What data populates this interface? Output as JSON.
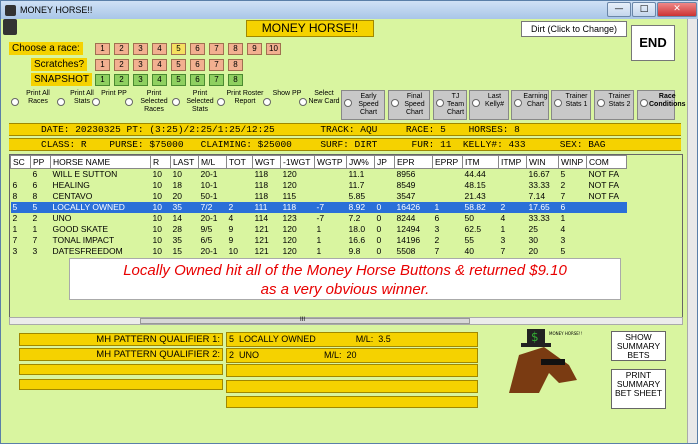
{
  "window": {
    "title": "MONEY HORSE!!",
    "close_label": "✕",
    "min_label": "—",
    "max_label": "□"
  },
  "header": {
    "app_title": "MONEY HORSE!!",
    "dirt_button": "Dirt (Click to Change)",
    "end_button": "END"
  },
  "race_row": {
    "label": "Choose  a race:",
    "options": [
      "1",
      "2",
      "3",
      "4",
      "5",
      "6",
      "7",
      "8",
      "9",
      "10"
    ],
    "selected": "5"
  },
  "scratch_row": {
    "label": "Scratches?",
    "options": [
      "1",
      "2",
      "3",
      "4",
      "5",
      "6",
      "7",
      "8"
    ]
  },
  "snapshot_row": {
    "label": "SNAPSHOT",
    "options": [
      "1",
      "2",
      "3",
      "4",
      "5",
      "6",
      "7",
      "8"
    ]
  },
  "print_options": [
    {
      "label": "Print All Races"
    },
    {
      "label": "Print All Stats"
    },
    {
      "label": "Print PP"
    },
    {
      "label": "Print Selected Races"
    },
    {
      "label": "Print Selected Stats"
    },
    {
      "label": "Print Roster Report"
    },
    {
      "label": "Show PP"
    },
    {
      "label": "Select New Card"
    }
  ],
  "chart_buttons": [
    {
      "label": "Early Speed Chart"
    },
    {
      "label": "Final Speed Chart"
    },
    {
      "label": "TJ Team Chart"
    },
    {
      "label": "Last Kelly#"
    },
    {
      "label": "Earning Chart"
    },
    {
      "label": "Trainer Stats 1"
    },
    {
      "label": "Trainer Stats 2"
    },
    {
      "label": "Race Conditions"
    }
  ],
  "info1": "DATE: 20230325 PT: (3:25)/2:25/1:25/12:25        TRACK: AQU     RACE: 5    HORSES: 8",
  "info2": "CLASS: R    PURSE: $75000   CLAIMING: $25000     SURF: DIRT      FUR: 11  KELLY#: 433      SEX: BAG",
  "table": {
    "headers": [
      "SC",
      "PP",
      "HORSE NAME",
      "R",
      "LAST",
      "M/L",
      "TOT",
      "WGT",
      "-1WGT",
      "WGTP",
      "JW%",
      "JP",
      "EPR",
      "EPRP",
      "ITM",
      "ITMP",
      "WIN",
      "WINP",
      "COM"
    ],
    "rows": [
      [
        "",
        "6",
        "WILL E SUTTON",
        "10",
        "10",
        "20-1",
        "",
        "118",
        "120",
        "",
        "11.1",
        "",
        "8956",
        "",
        "44.44",
        "",
        "16.67",
        "5",
        "NOT FA"
      ],
      [
        "6",
        "6",
        "HEALING",
        "10",
        "18",
        "10-1",
        "",
        "118",
        "120",
        "",
        "11.7",
        "",
        "8549",
        "",
        "48.15",
        "",
        "33.33",
        "2",
        "NOT FA"
      ],
      [
        "8",
        "8",
        "CENTAVO",
        "10",
        "20",
        "50-1",
        "",
        "118",
        "115",
        "",
        "5.85",
        "",
        "3547",
        "",
        "21.43",
        "",
        "7.14",
        "7",
        "NOT FA"
      ],
      [
        "5",
        "5",
        "LOCALLY OWNED",
        "10",
        "35",
        "7/2",
        "2",
        "111",
        "118",
        "-7",
        "8.92",
        "0",
        "16426",
        "1",
        "58.82",
        "2",
        "17.65",
        "6",
        ""
      ],
      [
        "2",
        "2",
        "UNO",
        "10",
        "14",
        "20-1",
        "4",
        "114",
        "123",
        "-7",
        "7.2",
        "0",
        "8244",
        "6",
        "50",
        "4",
        "33.33",
        "1",
        ""
      ],
      [
        "1",
        "1",
        "GOOD SKATE",
        "10",
        "28",
        "9/5",
        "9",
        "121",
        "120",
        "1",
        "18.0",
        "0",
        "12494",
        "3",
        "62.5",
        "1",
        "25",
        "4",
        ""
      ],
      [
        "7",
        "7",
        "TONAL IMPACT",
        "10",
        "35",
        "6/5",
        "9",
        "121",
        "120",
        "1",
        "16.6",
        "0",
        "14196",
        "2",
        "55",
        "3",
        "30",
        "3",
        ""
      ],
      [
        "3",
        "3",
        "DATESFREEDOM",
        "10",
        "15",
        "20-1",
        "10",
        "121",
        "120",
        "1",
        "9.8",
        "0",
        "5508",
        "7",
        "40",
        "7",
        "20",
        "5",
        ""
      ]
    ],
    "selected_index": 3
  },
  "overlay": {
    "line1": "Locally Owned hit all of the Money Horse Buttons & returned $9.10",
    "line2": "as a very obvious winner."
  },
  "scroll_grip": "III",
  "qualifiers": [
    {
      "label": "MH PATTERN QUALIFIER 1:",
      "value": "5  LOCALLY OWNED                M/L:  3.5"
    },
    {
      "label": "MH PATTERN QUALIFIER 2:",
      "value": "2  UNO                          M/L:  20"
    }
  ],
  "side_buttons": {
    "summary": "SHOW SUMMARY BETS",
    "print_summary": "PRINT SUMMARY BET SHEET"
  },
  "logo": {
    "text": "MONEY HORSE!!",
    "sign": "$"
  }
}
